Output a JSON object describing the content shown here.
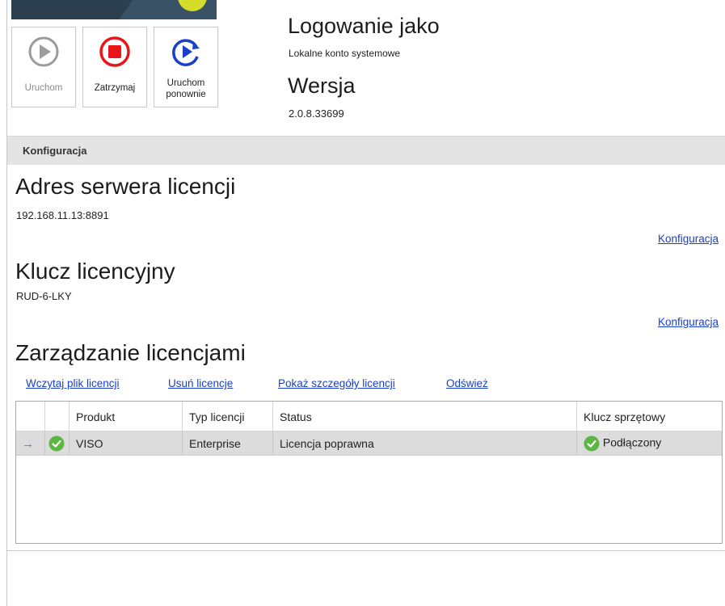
{
  "service_buttons": [
    {
      "label": "Uruchom",
      "enabled": false,
      "icon": "play-icon"
    },
    {
      "label": "Zatrzymaj",
      "enabled": true,
      "icon": "stop-icon"
    },
    {
      "label_line1": "Uruchom",
      "label_line2": "ponownie",
      "enabled": true,
      "icon": "restart-icon"
    }
  ],
  "login": {
    "title": "Logowanie jako",
    "value": "Lokalne konto systemowe"
  },
  "version": {
    "title": "Wersja",
    "value": "2.0.8.33699"
  },
  "config_section": {
    "title": "Konfiguracja"
  },
  "license_server": {
    "title": "Adres serwera licencji",
    "value": "192.168.11.13:8891",
    "link": "Konfiguracja"
  },
  "license_key": {
    "title": "Klucz licencyjny",
    "value": "RUD-6-LKY",
    "link": "Konfiguracja"
  },
  "license_mgmt": {
    "title": "Zarządzanie licencjami",
    "actions": [
      "Wczytaj plik licencji",
      "Usuń licencje",
      "Pokaż szczegóły licencji",
      "Odśwież"
    ]
  },
  "grid": {
    "columns": [
      "Produkt",
      "Typ licencji",
      "Status",
      "Klucz sprzętowy"
    ],
    "rows": [
      {
        "product": "VISO",
        "license_type": "Enterprise",
        "status": "Licencja poprawna",
        "hw_key": "Podłączony"
      }
    ]
  },
  "colors": {
    "accent_link": "#1a3fc9",
    "stop_red": "#e8141a",
    "restart_blue": "#1a3fc9",
    "ok_green": "#5cb544",
    "selection_row": "#dcdcdc"
  }
}
